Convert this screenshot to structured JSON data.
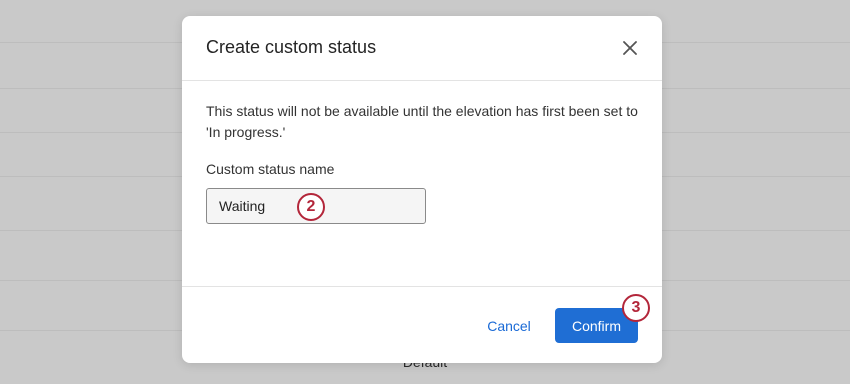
{
  "background": {
    "footer_text": "Default"
  },
  "modal": {
    "title": "Create custom status",
    "message": "This status will not be available until the elevation has first been set to 'In progress.'",
    "field_label": "Custom status name",
    "input_value": "Waiting",
    "cancel_label": "Cancel",
    "confirm_label": "Confirm"
  },
  "annotations": {
    "step_2": "2",
    "step_3": "3"
  },
  "colors": {
    "primary": "#1f6ed4",
    "link": "#1a6ad6",
    "annotation": "#b3263a",
    "overlay": "#c9c9c9"
  },
  "icons": {
    "close": "close-icon"
  }
}
